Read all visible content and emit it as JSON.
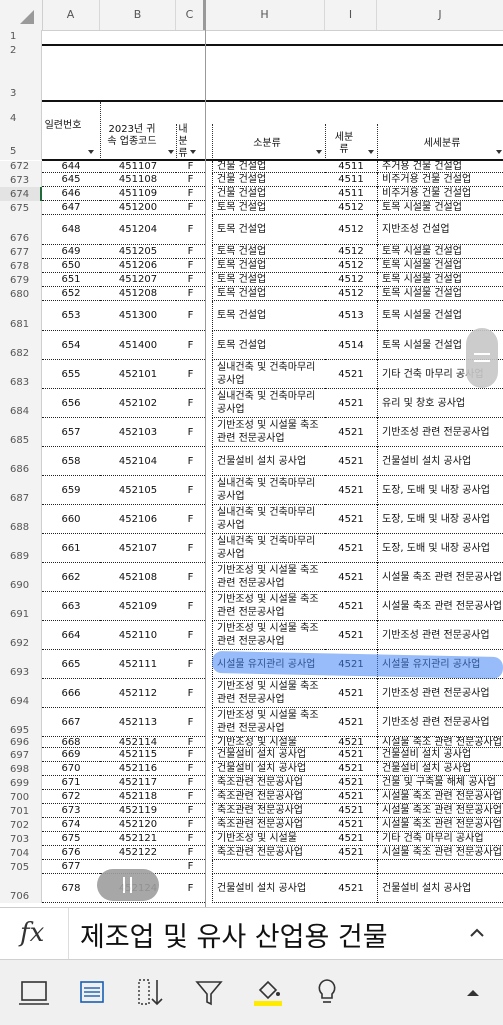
{
  "columns": [
    "A",
    "B",
    "C",
    "H",
    "I",
    "J"
  ],
  "top_rows": [
    "1",
    "2",
    "3",
    "4",
    "5"
  ],
  "header": {
    "col_a": "일련번호",
    "col_b": "2023년 귀속 업종코드",
    "col_c": "내분류",
    "col_h": "소분류",
    "col_i": "세분류",
    "col_j": "세세분류"
  },
  "rows": [
    {
      "r": "672",
      "a": "644",
      "b": "451107",
      "c": "F",
      "h": "건물 건설업",
      "i": "4511",
      "j": "주거용 건물 건설업"
    },
    {
      "r": "673",
      "a": "645",
      "b": "451108",
      "c": "F",
      "h": "건물 건설업",
      "i": "4511",
      "j": "비주거용 건물 건설업"
    },
    {
      "r": "674",
      "a": "646",
      "b": "451109",
      "c": "F",
      "h": "건물 건설업",
      "i": "4511",
      "j": "비주거용 건물 건설업"
    },
    {
      "r": "675",
      "a": "647",
      "b": "451200",
      "c": "F",
      "h": "토목 건설업",
      "i": "4512",
      "j": "토목 시설물 건설업"
    },
    {
      "r": "676",
      "a": "648",
      "b": "451204",
      "c": "F",
      "h": "토목 건설업",
      "i": "4512",
      "j": "지반조성 건설업"
    },
    {
      "r": "677",
      "a": "649",
      "b": "451205",
      "c": "F",
      "h": "토목 건설업",
      "i": "4512",
      "j": "토목 시설물 건설업"
    },
    {
      "r": "678",
      "a": "650",
      "b": "451206",
      "c": "F",
      "h": "토목 건설업",
      "i": "4512",
      "j": "토목 시설물 건설업"
    },
    {
      "r": "679",
      "a": "651",
      "b": "451207",
      "c": "F",
      "h": "토목 건설업",
      "i": "4512",
      "j": "토목 시설물 건설업"
    },
    {
      "r": "680",
      "a": "652",
      "b": "451208",
      "c": "F",
      "h": "토목 건설업",
      "i": "4512",
      "j": "토목 시설물 건설업"
    },
    {
      "r": "681",
      "a": "653",
      "b": "451300",
      "c": "F",
      "h": "토목 건설업",
      "i": "4513",
      "j": "토목 시설물 건설업"
    },
    {
      "r": "682",
      "a": "654",
      "b": "451400",
      "c": "F",
      "h": "토목 건설업",
      "i": "4514",
      "j": "토목 시설물 건설업"
    },
    {
      "r": "683",
      "a": "655",
      "b": "452101",
      "c": "F",
      "h": "실내건축 및 건축마무리 공사업",
      "i": "4521",
      "j": "기타 건축 마무리 공사업"
    },
    {
      "r": "684",
      "a": "656",
      "b": "452102",
      "c": "F",
      "h": "실내건축 및 건축마무리 공사업",
      "i": "4521",
      "j": "유리 및 창호 공사업"
    },
    {
      "r": "685",
      "a": "657",
      "b": "452103",
      "c": "F",
      "h": "기반조성 및 시설물 축조관련 전문공사업",
      "i": "4521",
      "j": "기반조성 관련 전문공사업"
    },
    {
      "r": "686",
      "a": "658",
      "b": "452104",
      "c": "F",
      "h": "건물설비 설치 공사업",
      "i": "4521",
      "j": "건물설비 설치 공사업"
    },
    {
      "r": "687",
      "a": "659",
      "b": "452105",
      "c": "F",
      "h": "실내건축 및 건축마무리 공사업",
      "i": "4521",
      "j": "도장, 도배 및 내장 공사업"
    },
    {
      "r": "688",
      "a": "660",
      "b": "452106",
      "c": "F",
      "h": "실내건축 및 건축마무리 공사업",
      "i": "4521",
      "j": "도장, 도배 및 내장 공사업"
    },
    {
      "r": "689",
      "a": "661",
      "b": "452107",
      "c": "F",
      "h": "실내건축 및 건축마무리 공사업",
      "i": "4521",
      "j": "도장, 도배 및 내장 공사업"
    },
    {
      "r": "690",
      "a": "662",
      "b": "452108",
      "c": "F",
      "h": "기반조성 및 시설물 축조관련 전문공사업",
      "i": "4521",
      "j": "시설물 축조 관련 전문공사업"
    },
    {
      "r": "691",
      "a": "663",
      "b": "452109",
      "c": "F",
      "h": "기반조성 및 시설물 축조관련 전문공사업",
      "i": "4521",
      "j": "시설물 축조 관련 전문공사업"
    },
    {
      "r": "692",
      "a": "664",
      "b": "452110",
      "c": "F",
      "h": "기반조성 및 시설물 축조관련 전문공사업",
      "i": "4521",
      "j": "기반조성 관련 전문공사업"
    },
    {
      "r": "693",
      "a": "665",
      "b": "452111",
      "c": "F",
      "h": "시설물 유지관리 공사업",
      "i": "4521",
      "j": "시설물 유지관리 공사업"
    },
    {
      "r": "694",
      "a": "666",
      "b": "452112",
      "c": "F",
      "h": "기반조성 및 시설물 축조관련 전문공사업",
      "i": "4521",
      "j": "기반조성 관련 전문공사업"
    },
    {
      "r": "695",
      "a": "667",
      "b": "452113",
      "c": "F",
      "h": "기반조성 및 시설물 축조관련 전문공사업",
      "i": "4521",
      "j": "기반조성 관련 전문공사업"
    },
    {
      "r": "696",
      "a": "668",
      "b": "452114",
      "c": "F",
      "h": "기반조성 및 시설물",
      "i": "4521",
      "j": "시설물 축조 관련 전문공사업"
    },
    {
      "r": "697",
      "a": "669",
      "b": "452115",
      "c": "F",
      "h": "건물설비 설치 공사업",
      "i": "4521",
      "j": "건물설비 설치 공사업"
    },
    {
      "r": "698",
      "a": "670",
      "b": "452116",
      "c": "F",
      "h": "건물설비 설치 공사업",
      "i": "4521",
      "j": "건물설비 설치 공사업"
    },
    {
      "r": "699",
      "a": "671",
      "b": "452117",
      "c": "F",
      "h": "축조관련 전문공사업",
      "i": "4521",
      "j": "건물 및 구축물 해체 공사업"
    },
    {
      "r": "700",
      "a": "672",
      "b": "452118",
      "c": "F",
      "h": "축조관련 전문공사업",
      "i": "4521",
      "j": "시설물 축조 관련 전문공사업"
    },
    {
      "r": "701",
      "a": "673",
      "b": "452119",
      "c": "F",
      "h": "축조관련 전문공사업",
      "i": "4521",
      "j": "시설물 축조 관련 전문공사업"
    },
    {
      "r": "702",
      "a": "674",
      "b": "452120",
      "c": "F",
      "h": "축조관련 전문공사업",
      "i": "4521",
      "j": "시설물 축조 관련 전문공사업"
    },
    {
      "r": "703",
      "a": "675",
      "b": "452121",
      "c": "F",
      "h": "기반조성 및 시설물",
      "i": "4521",
      "j": "기타 건축 마무리 공사업"
    },
    {
      "r": "704",
      "a": "676",
      "b": "452122",
      "c": "F",
      "h": "축조관련 전문공사업",
      "i": "4521",
      "j": "시설물 축조 관련 전문공사업"
    },
    {
      "r": "705",
      "a": "677",
      "b": "",
      "c": "F",
      "h": "",
      "i": "",
      "j": ""
    },
    {
      "r": "706",
      "a": "678",
      "b": "452124",
      "c": "F",
      "h": "건물설비 설치 공사업",
      "i": "4521",
      "j": "건물설비 설치 공사업"
    }
  ],
  "formula_bar": {
    "fx_label": "fx",
    "content": "제조업 및 유사 산업용 건물",
    "expand_icon": "chevron-up-icon"
  },
  "toolbar": {
    "icons": [
      "sheet-view-icon",
      "card-view-icon",
      "sort-icon",
      "filter-icon",
      "fill-color-icon",
      "idea-icon"
    ],
    "fill_color": "#ffeb00",
    "more_icon": "caret-up-icon"
  },
  "selection_row": "674",
  "highlight_cell": "693"
}
